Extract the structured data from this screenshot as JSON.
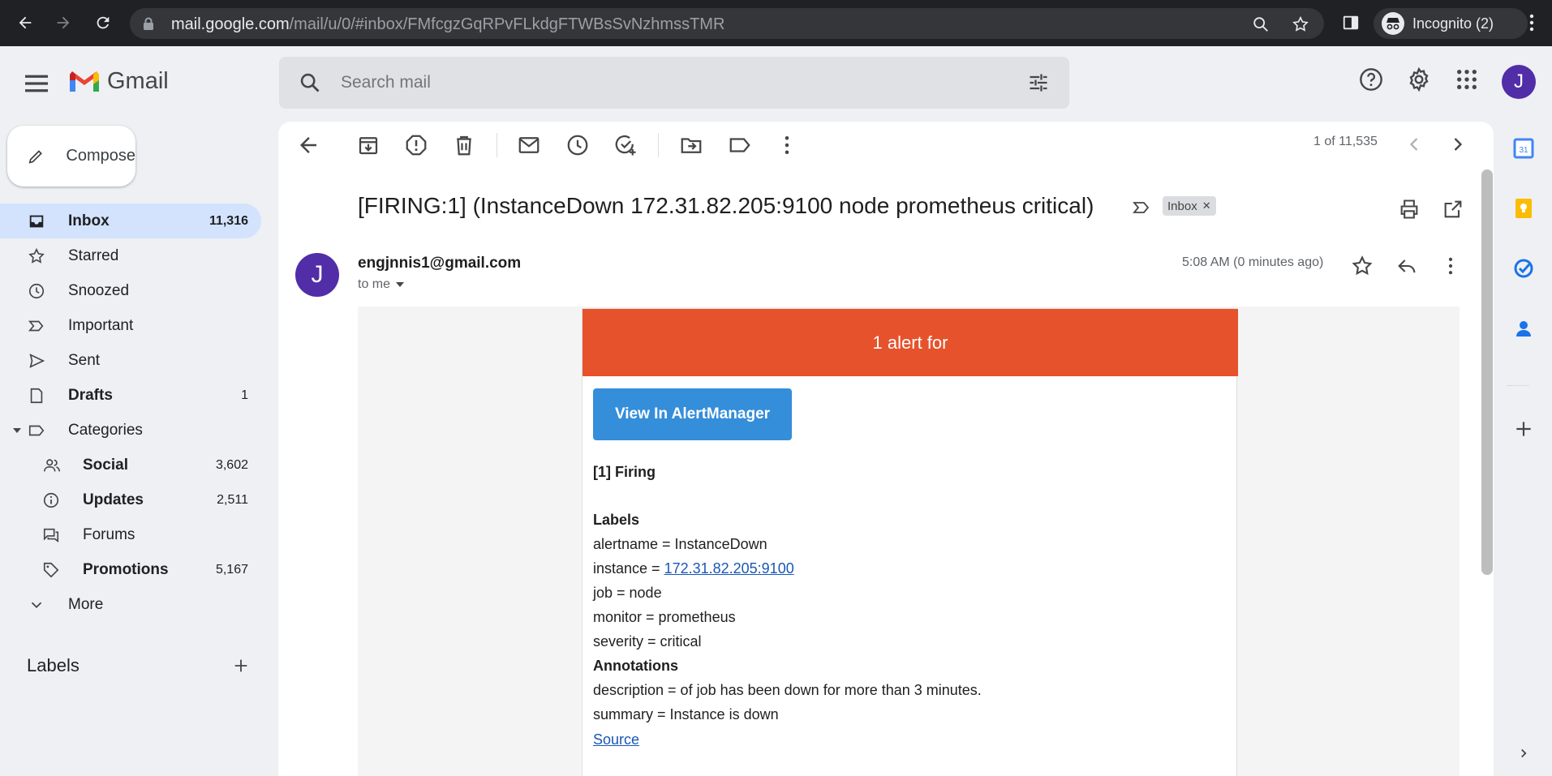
{
  "browser": {
    "url_host": "mail.google.com",
    "url_path": "/mail/u/0/#inbox/FMfcgzGqRPvFLkdgFTWBsSvNzhmssTMR",
    "profile_label": "Incognito (2)"
  },
  "app": {
    "name": "Gmail",
    "search_placeholder": "Search mail",
    "avatar_letter": "J"
  },
  "sidebar": {
    "compose_label": "Compose",
    "items": [
      {
        "label": "Inbox",
        "count": "11,316",
        "icon": "inbox-icon"
      },
      {
        "label": "Starred",
        "count": "",
        "icon": "star-icon"
      },
      {
        "label": "Snoozed",
        "count": "",
        "icon": "clock-icon"
      },
      {
        "label": "Important",
        "count": "",
        "icon": "important-icon"
      },
      {
        "label": "Sent",
        "count": "",
        "icon": "send-icon"
      },
      {
        "label": "Drafts",
        "count": "1",
        "icon": "draft-icon"
      },
      {
        "label": "Categories",
        "count": "",
        "icon": "label-icon"
      },
      {
        "label": "Social",
        "count": "3,602",
        "icon": "people-icon"
      },
      {
        "label": "Updates",
        "count": "2,511",
        "icon": "info-icon"
      },
      {
        "label": "Forums",
        "count": "",
        "icon": "forum-icon"
      },
      {
        "label": "Promotions",
        "count": "5,167",
        "icon": "tag-icon"
      },
      {
        "label": "More",
        "count": "",
        "icon": "chevron-down-icon"
      }
    ],
    "labels_heading": "Labels"
  },
  "toolbar": {
    "pager": "1 of 11,535"
  },
  "message": {
    "subject": "[FIRING:1] (InstanceDown 172.31.82.205:9100 node prometheus critical)",
    "tag": "Inbox",
    "sender_initial": "J",
    "sender": "engjnnis1@gmail.com",
    "to": "to me",
    "time": "5:08 AM (0 minutes ago)"
  },
  "email": {
    "header": "1 alert for",
    "button": "View In AlertManager",
    "firing": "[1] Firing",
    "labels_title": "Labels",
    "alertname": "alertname = InstanceDown",
    "instance_prefix": "instance = ",
    "instance_link": "172.31.82.205:9100",
    "job": "job = node",
    "monitor": "monitor = prometheus",
    "severity": "severity = critical",
    "annotations_title": "Annotations",
    "description": "description = of job has been down for more than 3 minutes.",
    "summary": "summary = Instance is down",
    "source": "Source"
  },
  "colors": {
    "alert_header": "#e6522c",
    "button": "#348eda",
    "avatar": "#512da8",
    "active_nav": "#d3e3fd"
  }
}
